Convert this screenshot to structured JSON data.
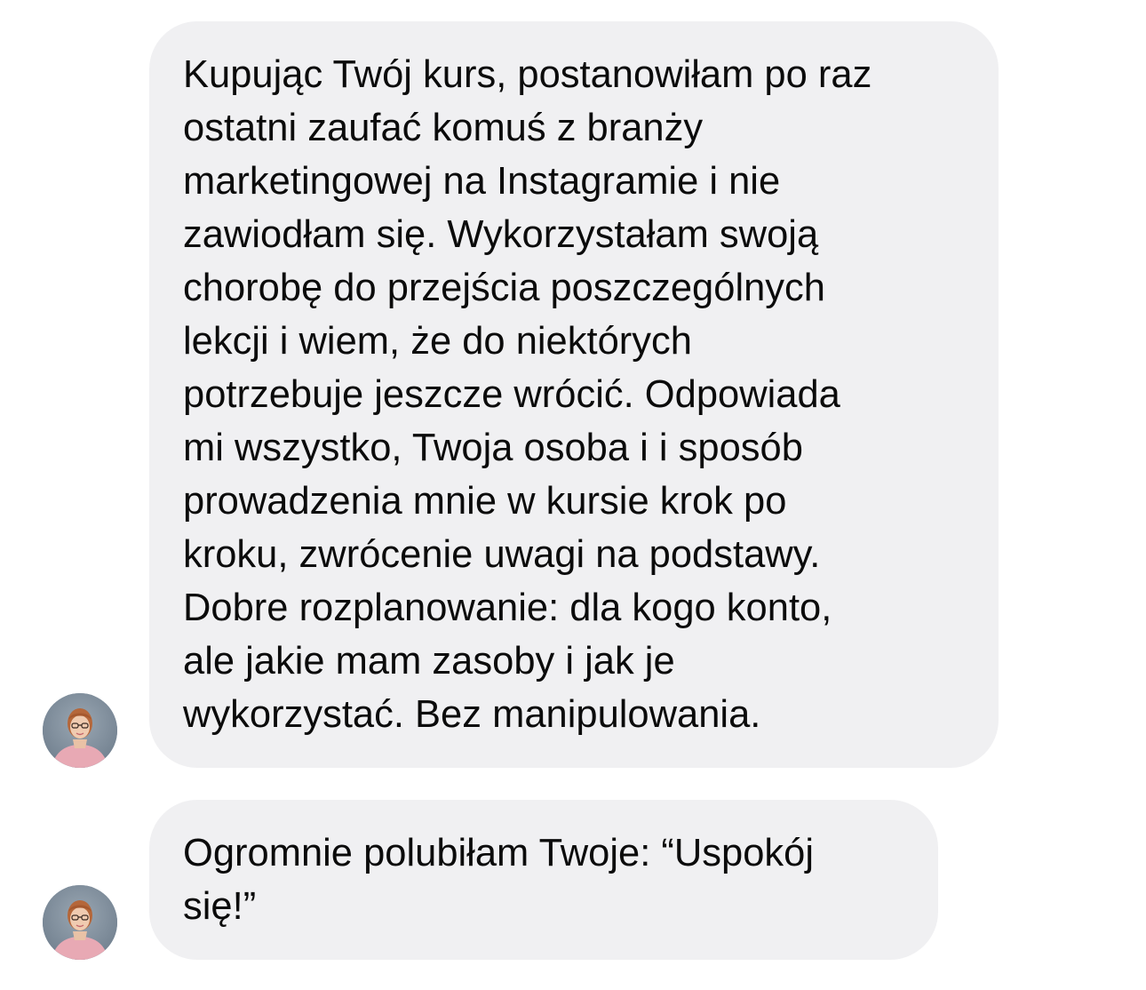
{
  "messages": [
    {
      "text": "Kupując Twój kurs, postanowiłam po raz\nostatni zaufać komuś z branży\nmarketingowej na Instagramie i nie\nzawiodłam się. Wykorzystałam swoją\nchorobę do przejścia poszczególnych\nlekcji i wiem, że do niektórych\npotrzebuje jeszcze wrócić. Odpowiada\nmi wszystko, Twoja osoba i i sposób\nprowadzenia mnie w kursie krok po\nkroku, zwrócenie uwagi na podstawy.\nDobre rozplanowanie:  dla kogo konto,\nale jakie mam zasoby i jak je\nwykorzystać. Bez manipulowania.",
      "avatar_icon": "user-avatar"
    },
    {
      "text": "Ogromnie polubiłam Twoje: “Uspokój\nsię!”",
      "avatar_icon": "user-avatar"
    }
  ],
  "colors": {
    "bubble_background": "#f0f0f2",
    "text": "#0b0b0b",
    "page_background": "#ffffff"
  }
}
